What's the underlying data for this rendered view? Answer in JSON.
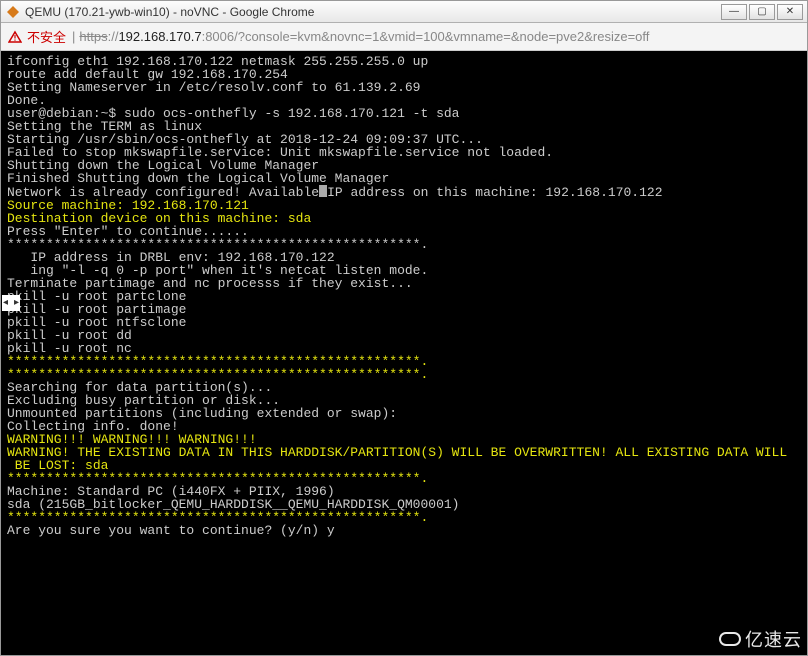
{
  "window": {
    "title": "QEMU (170.21-ywb-win10) - noVNC - Google Chrome",
    "controls": {
      "min": "—",
      "max": "▢",
      "close": "✕"
    }
  },
  "addressbar": {
    "insecure_label": "不安全",
    "scheme_strike": "https",
    "sep": "://",
    "host": "192.168.170.7",
    "rest": ":8006/?console=kvm&novnc=1&vmid=100&vmname=&node=pve2&resize=off"
  },
  "terminal": {
    "lines": [
      {
        "cls": "c-white",
        "text": "ifconfig eth1 192.168.170.122 netmask 255.255.255.0 up"
      },
      {
        "cls": "c-white",
        "text": "route add default gw 192.168.170.254"
      },
      {
        "cls": "c-white",
        "text": "Setting Nameserver in /etc/resolv.conf to 61.139.2.69"
      },
      {
        "cls": "c-white",
        "text": "Done."
      },
      {
        "cls": "c-white",
        "text": "user@debian:~$ sudo ocs-onthefly -s 192.168.170.121 -t sda"
      },
      {
        "cls": "c-white",
        "text": "Setting the TERM as linux"
      },
      {
        "cls": "c-white",
        "text": "Starting /usr/sbin/ocs-onthefly at 2018-12-24 09:09:37 UTC..."
      },
      {
        "cls": "c-white",
        "text": "Failed to stop mkswapfile.service: Unit mkswapfile.service not loaded."
      },
      {
        "cls": "c-white",
        "text": "Shutting down the Logical Volume Manager"
      },
      {
        "cls": "c-white",
        "text": "Finished Shutting down the Logical Volume Manager"
      },
      {
        "cls": "c-white",
        "seg": [
          {
            "text": "Network is already configured! Available"
          },
          {
            "cursor": true
          },
          {
            "text": "IP address on this machine: 192.168.170.122"
          }
        ]
      },
      {
        "cls": "c-yellow",
        "text": "Source machine: 192.168.170.121"
      },
      {
        "cls": "c-yellow",
        "text": "Destination device on this machine: sda"
      },
      {
        "cls": "c-white",
        "text": "Press \"Enter\" to continue......"
      },
      {
        "cls": "c-white",
        "text": "*****************************************************."
      },
      {
        "cls": "c-white",
        "text": "   IP address in DRBL env: 192.168.170.122"
      },
      {
        "cls": "c-white",
        "text": "   ing \"-l -q 0 -p port\" when it's netcat listen mode."
      },
      {
        "cls": "c-white",
        "text": "Terminate partimage and nc processs if they exist..."
      },
      {
        "cls": "c-white",
        "text": "pkill -u root partclone"
      },
      {
        "cls": "c-white",
        "text": "pkill -u root partimage"
      },
      {
        "cls": "c-white",
        "text": "pkill -u root ntfsclone"
      },
      {
        "cls": "c-white",
        "text": "pkill -u root dd"
      },
      {
        "cls": "c-white",
        "text": "pkill -u root nc"
      },
      {
        "cls": "c-yellow",
        "text": "*****************************************************."
      },
      {
        "cls": "c-yellow",
        "text": "*****************************************************."
      },
      {
        "cls": "c-white",
        "text": "Searching for data partition(s)..."
      },
      {
        "cls": "c-white",
        "text": "Excluding busy partition or disk..."
      },
      {
        "cls": "c-white",
        "text": "Unmounted partitions (including extended or swap):"
      },
      {
        "cls": "c-white",
        "text": "Collecting info. done!"
      },
      {
        "cls": "c-yellow",
        "text": "WARNING!!! WARNING!!! WARNING!!!"
      },
      {
        "cls": "c-yellow",
        "text": "WARNING! THE EXISTING DATA IN THIS HARDDISK/PARTITION(S) WILL BE OVERWRITTEN! ALL EXISTING DATA WILL"
      },
      {
        "cls": "c-yellow",
        "text": " BE LOST: sda"
      },
      {
        "cls": "c-yellow",
        "text": "*****************************************************."
      },
      {
        "cls": "c-white",
        "text": "Machine: Standard PC (i440FX + PIIX, 1996)"
      },
      {
        "cls": "c-white",
        "text": "sda (215GB_bitlocker_QEMU_HARDDISK__QEMU_HARDDISK_QM00001)"
      },
      {
        "cls": "c-yellow",
        "text": "*****************************************************."
      },
      {
        "cls": "c-white",
        "text": "Are you sure you want to continue? (y/n) y"
      },
      {
        "cls": "c-white",
        "text": ""
      },
      {
        "cls": "c-white",
        "text": ""
      },
      {
        "cls": "c-white",
        "text": ""
      },
      {
        "cls": "c-white",
        "text": ""
      },
      {
        "cls": "c-white",
        "text": ""
      },
      {
        "cls": "c-white",
        "text": ""
      },
      {
        "cls": "c-white",
        "text": ""
      },
      {
        "cls": "c-white",
        "text": ""
      }
    ]
  },
  "watermark": {
    "text": "亿速云"
  }
}
